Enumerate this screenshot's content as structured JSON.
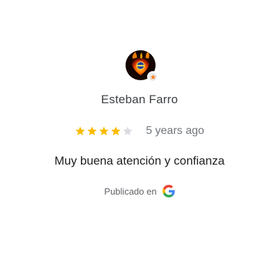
{
  "review": {
    "author_name": "Esteban Farro",
    "rating": 4,
    "max_rating": 5,
    "time_ago": "5 years ago",
    "text": "Muy buena atención y confianza",
    "published_label": "Publicado en",
    "source_icon": "google-g-icon",
    "avatar_icon": "fire-heart-avatar",
    "badge_icon": "local-guide-star-icon"
  },
  "colors": {
    "star_filled": "#fbbc04",
    "star_empty": "#dadce0",
    "author_text": "#3c4043",
    "muted_text": "#70757a",
    "review_text": "#202124"
  }
}
